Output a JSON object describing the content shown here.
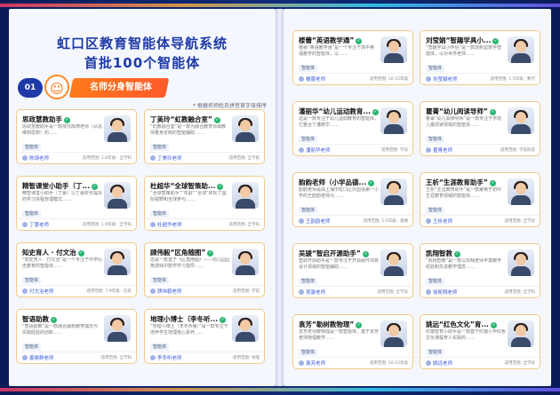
{
  "title_line1": "虹口区教育智能体导航系统",
  "title_line2": "首批100个智能体",
  "section": {
    "number": "01",
    "label": "名师分身智能体"
  },
  "note": "* 根据名师姓氏拼音首字母排序",
  "cards_left": [
    {
      "name": "思政慧教助手",
      "desc": "思政慧教助手是一款依托陈琦老师（从思维到思想）的……",
      "tag": "智能体",
      "author": "陈琦老师",
      "scope": "适用范围: 1-6年级 · 全学科"
    },
    {
      "name": "丁美玲“虹教融合室”",
      "desc": "“虹教融合室”是一款为融合教育领域教师量身定制的智能辅助……",
      "tag": "智能体",
      "author": "丁美玲老师",
      "scope": "适用范围: 全学段"
    },
    {
      "name": "精智课堂小助手（丁...",
      "desc": "精智课堂小助手（丁蕾）以丁蕾校长提出的学习进程管理模式……",
      "tag": "智能体",
      "author": "丁蕾老师",
      "scope": "适用范围: 1-9年级 · 全学科"
    },
    {
      "name": "杜超华“全球智策助...",
      "desc": "“全球智策助手”“年龄”“全球”体现了国际视野和全球参与……",
      "tag": "智能体",
      "author": "杜超华老师",
      "scope": "适用范围: 全学科"
    },
    {
      "name": "知史育人 · 付文治",
      "desc": "“知史育人 · 付文治”是一个专注于中学历史教育的智能体……",
      "tag": "智能体",
      "author": "付文治老师",
      "scope": "适用范围: 7-9年级 · 历史"
    },
    {
      "name": "顾伟毅“区角随图”",
      "desc": "这是一款基于《区角随图》——幼儿园区角游戏中数学学习指导……",
      "tag": "智能体",
      "author": "顾伟毅老师",
      "scope": "适用范围: 学前"
    },
    {
      "name": "智语助教",
      "desc": "“智语助教”是一款融合最新教育理念与实践经验的创新……",
      "tag": "智能体",
      "author": "姜振群老师",
      "scope": "适用范围: 全学科"
    },
    {
      "name": "地理小博士（李冬听...",
      "desc": "“地理小博士（李冬听版）”是一款专注于培养学生地理核心素养……",
      "tag": "智能体",
      "author": "李冬听老师",
      "scope": "适用范围: 地理"
    }
  ],
  "cards_right": [
    {
      "name": "楼蕾“英语教学通”",
      "desc": "楼蕾“英语教学通”是一个专注于高中英语教学的智能体，以……",
      "tag": "智能体",
      "author": "楼蕾老师",
      "scope": "适用范围: 10-12年级"
    },
    {
      "name": "刘莹娟“智趣学具小...",
      "desc": "“智趣学具小伴侣”是一款创新型数学智能体，以对世界老师……",
      "tag": "智能体",
      "author": "刘莹娟老师",
      "scope": "适用范围: 1-5年级 · 数学"
    },
    {
      "name": "潘丽华“幼儿运动教育...",
      "desc": "这是一款专注于幼儿运动教育的智能体，它整合了潘丽华……",
      "tag": "智能体",
      "author": "潘丽华老师",
      "scope": "适用范围: 学前"
    },
    {
      "name": "瞿菁“幼儿阅读导师”",
      "desc": "瞿菁“幼儿阅读导师”是一款专注于学前儿童阅读领域的智能体……",
      "tag": "智能体",
      "author": "瞿菁老师",
      "scope": "适用范围: 学前阶段"
    },
    {
      "name": "韵韵老师（小学品德...",
      "desc": "韵韵老师是由上海市虹口区外国语第一小学的王韵韵老师为……",
      "tag": "智能体",
      "author": "王韵韵老师",
      "scope": "适用范围: 1-5年级 · 道德"
    },
    {
      "name": "王析“生涯教育助手”",
      "desc": "王析“生涯教育助手”是一款聚焦于初中生涯教育领域的智能体……",
      "tag": "智能体",
      "author": "王析老师",
      "scope": "适用范围: 全学段"
    },
    {
      "name": "吴骏“智启开源助手”",
      "desc": "智启开源助手是一款专注于开源硬件项目设计领域的智能辅助……",
      "tag": "智能体",
      "author": "吴骏老师",
      "scope": "适用范围: 全学段"
    },
    {
      "name": "凯翔智教",
      "desc": "“凯翔智教”是一款以凯翔老师丰富教学经验和先进教学理念……",
      "tag": "智能体",
      "author": "徐凯翔老师",
      "scope": "适用范围: 全学科"
    },
    {
      "name": "袁芳“勒树教物理”",
      "desc": "袁芳老师教物理是一款智能体，基于袁芳老师物理教学……",
      "tag": "智能体",
      "author": "袁芳老师",
      "scope": "适用范围: 10-12年级"
    },
    {
      "name": "姚远“红色文化”育...",
      "desc": "红旗智育小助手是一款基于红旗小学红色文化课程育人实践的……",
      "tag": "智能体",
      "author": "姚远老师",
      "scope": "适用范围: 全学段"
    }
  ],
  "colors": {
    "title": "#1f3aa7",
    "accent": "#ff7a1a",
    "card_border": "#f0c98a",
    "verified": "#2bb673"
  },
  "icons": {
    "section": "teacher-icon",
    "verified": "check-icon",
    "author": "user-icon"
  }
}
